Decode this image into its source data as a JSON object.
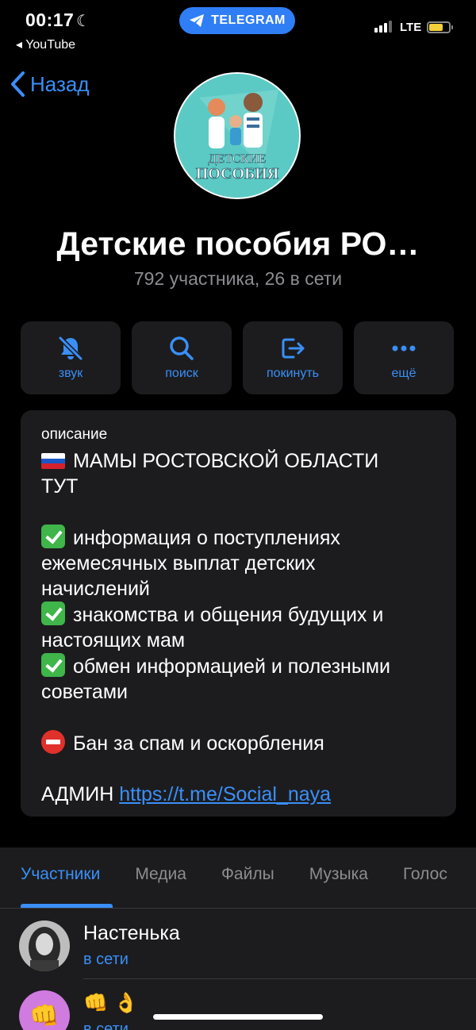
{
  "status_bar": {
    "time": "00:17",
    "back_app": "◂ YouTube",
    "pill_label": "TELEGRAM",
    "network": "LTE"
  },
  "nav": {
    "back_label": "Назад"
  },
  "group": {
    "avatar_text_line1": "ДЕТСКИЕ",
    "avatar_text_line2": "ПОСОБИЯ",
    "title": "Детские пособия РО…",
    "subtitle": "792 участника, 26 в сети"
  },
  "actions": [
    {
      "label": "звук",
      "icon": "bell-muted-icon"
    },
    {
      "label": "поиск",
      "icon": "search-icon"
    },
    {
      "label": "покинуть",
      "icon": "leave-icon"
    },
    {
      "label": "ещё",
      "icon": "more-icon"
    }
  ],
  "description": {
    "header": "описание",
    "line1": "МАМЫ РОСТОВСКОЙ ОБЛАСТИ",
    "line2": "ТУТ",
    "item1_a": "информация о поступлениях",
    "item1_b": "ежемесячных выплат детских",
    "item1_c": "начислений",
    "item2_a": "знакомства и общения будущих и",
    "item2_b": "настоящих мам",
    "item3_a": "обмен информацией и полезными",
    "item3_b": "советами",
    "ban": "Бан за спам и оскорбления",
    "admin_label": "АДМИН ",
    "admin_link": "https://t.me/Social_naya"
  },
  "tabs": [
    "Участники",
    "Медиа",
    "Файлы",
    "Музыка",
    "Голос"
  ],
  "members": [
    {
      "name": "Настенька",
      "status": "в сети"
    },
    {
      "name": "👊 👌",
      "status": "в сети"
    }
  ],
  "colors": {
    "accent": "#3a8ff7",
    "card": "#1c1c1e",
    "pill": "#2f7ef6"
  }
}
